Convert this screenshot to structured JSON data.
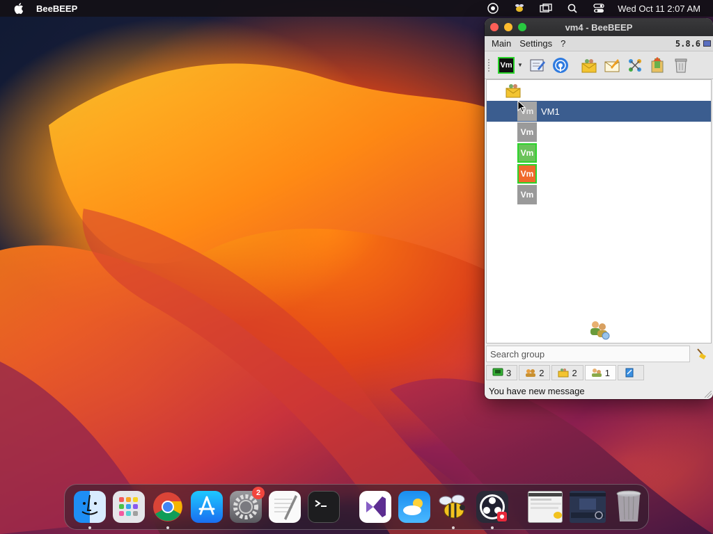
{
  "menubar": {
    "app_name": "BeeBEEP",
    "clock": "Wed Oct 11  2:07 AM",
    "icons": [
      "apple-icon",
      "screen-share-icon",
      "beebeep-tray-icon",
      "window-mirror-icon",
      "spotlight-icon",
      "control-center-icon"
    ]
  },
  "window": {
    "title": "vm4 - BeeBEEP",
    "menu": {
      "main": "Main",
      "settings": "Settings",
      "help": "?"
    },
    "version": "5.8.6",
    "toolbar": {
      "status_badge": "Vm",
      "icons": [
        "status-icon",
        "edit-profile-icon",
        "broadcast-icon",
        "group-chat-icon",
        "compose-icon",
        "network-icon",
        "share-icon",
        "trash-icon"
      ]
    },
    "users": [
      {
        "avatar": "Vm",
        "name": "VM1",
        "color": "sel",
        "selected": true
      },
      {
        "avatar": "Vm",
        "name": "",
        "color": "gray",
        "selected": false
      },
      {
        "avatar": "Vm",
        "name": "",
        "color": "green",
        "selected": false
      },
      {
        "avatar": "Vm",
        "name": "",
        "color": "orange",
        "selected": false
      },
      {
        "avatar": "Vm",
        "name": "",
        "color": "gray",
        "selected": false
      }
    ],
    "search_placeholder": "Search group",
    "tabs": [
      {
        "icon": "chat-icon",
        "count": "3"
      },
      {
        "icon": "users-icon",
        "count": "2"
      },
      {
        "icon": "groups-icon",
        "count": "2"
      },
      {
        "icon": "people-icon",
        "count": "1"
      },
      {
        "icon": "file-icon",
        "count": ""
      }
    ],
    "status_message": "You have new message"
  },
  "dock": {
    "apps": [
      "Finder",
      "Launchpad",
      "Google Chrome",
      "App Store",
      "System Settings",
      "TextEdit",
      "Terminal",
      "Visual Studio",
      "Weather",
      "BeeBEEP",
      "OBS"
    ],
    "settings_badge": "2"
  },
  "colors": {
    "selection": "#3b5d8f",
    "online_border": "#2bd42b",
    "avatar_orange": "#f06a2c"
  }
}
